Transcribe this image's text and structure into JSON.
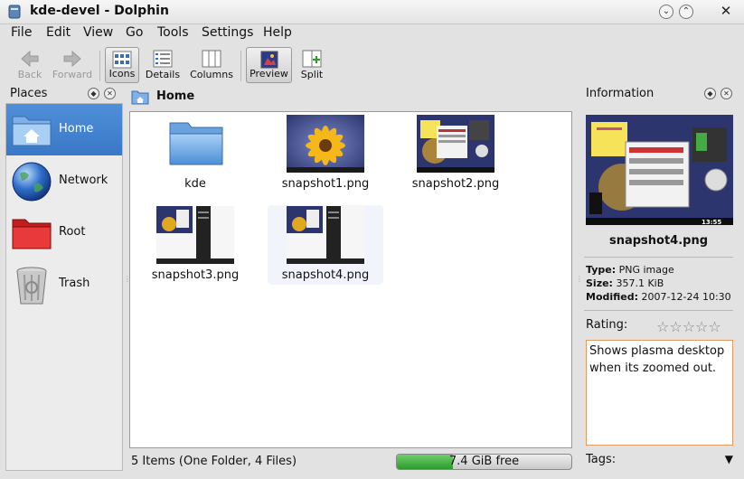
{
  "window": {
    "title": "kde-devel - Dolphin"
  },
  "menubar": [
    "File",
    "Edit",
    "View",
    "Go",
    "Tools",
    "Settings",
    "Help"
  ],
  "toolbar": {
    "back": "Back",
    "forward": "Forward",
    "icons": "Icons",
    "details": "Details",
    "columns": "Columns",
    "preview": "Preview",
    "split": "Split"
  },
  "places": {
    "title": "Places",
    "items": [
      {
        "label": "Home",
        "icon": "home-folder-icon"
      },
      {
        "label": "Network",
        "icon": "network-globe-icon"
      },
      {
        "label": "Root",
        "icon": "red-folder-icon"
      },
      {
        "label": "Trash",
        "icon": "trash-icon"
      }
    ]
  },
  "location": {
    "label": "Home"
  },
  "files": [
    {
      "name": "kde"
    },
    {
      "name": "snapshot1.png"
    },
    {
      "name": "snapshot2.png"
    },
    {
      "name": "snapshot3.png"
    },
    {
      "name": "snapshot4.png"
    }
  ],
  "status": {
    "text": "5 Items (One Folder, 4 Files)",
    "free": "7.4 GiB free",
    "free_fraction": 0.32
  },
  "info": {
    "title": "Information",
    "filename": "snapshot4.png",
    "type_label": "Type:",
    "type": "PNG image",
    "size_label": "Size:",
    "size": "357.1 KiB",
    "modified_label": "Modified:",
    "modified": "2007-12-24 10:30",
    "rating_label": "Rating:",
    "rating": 0,
    "comment": "Shows plasma desktop when its zoomed out.",
    "tags_label": "Tags:"
  },
  "colors": {
    "selection": "#3a78c8",
    "free_space": "#2e9a2e",
    "comment_border": "#e29b60"
  }
}
